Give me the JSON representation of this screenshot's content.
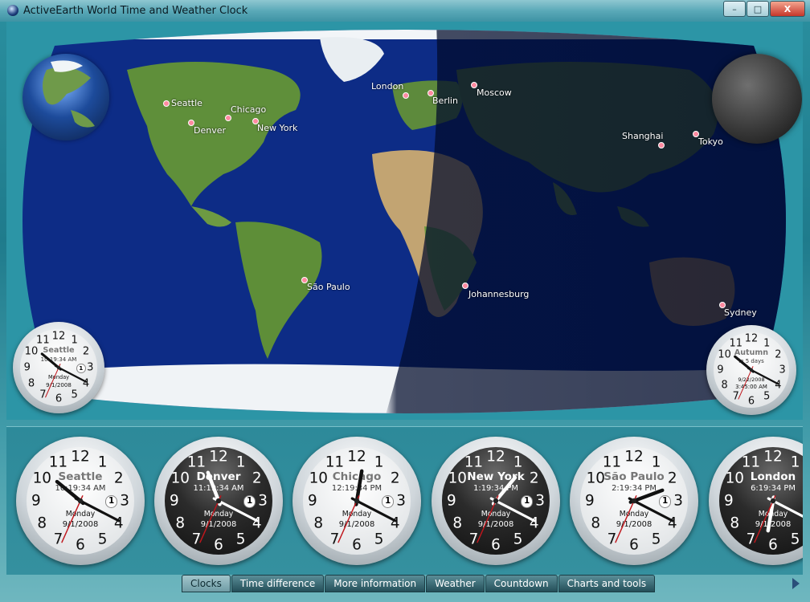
{
  "window": {
    "title": "ActiveEarth World Time and Weather Clock"
  },
  "controls": {
    "minimize": "–",
    "maximize": "□",
    "close": "X"
  },
  "map": {
    "cities": [
      {
        "name": "Seattle"
      },
      {
        "name": "Denver"
      },
      {
        "name": "Chicago"
      },
      {
        "name": "New York"
      },
      {
        "name": "London"
      },
      {
        "name": "Berlin"
      },
      {
        "name": "Moscow"
      },
      {
        "name": "Shanghai"
      },
      {
        "name": "Tokyo"
      },
      {
        "name": "São Paulo"
      },
      {
        "name": "Johannesburg"
      },
      {
        "name": "Sydney"
      }
    ]
  },
  "small_clocks": [
    {
      "city": "Seattle",
      "time": "10:19:34 AM",
      "day": "Monday",
      "date": "9/1/2008",
      "badge": "1",
      "theme": "light"
    },
    {
      "city": "Autumn",
      "time": "in 5 days",
      "day": "9/22/2008",
      "date": "3:45:00 AM",
      "badge": "",
      "theme": "light"
    }
  ],
  "clocks": [
    {
      "city": "Seattle",
      "time": "10:19:34 AM",
      "day": "Monday",
      "date": "9/1/2008",
      "badge": "1",
      "theme": "light"
    },
    {
      "city": "Denver",
      "time": "11:19:34 AM",
      "day": "Monday",
      "date": "9/1/2008",
      "badge": "1",
      "theme": "dark"
    },
    {
      "city": "Chicago",
      "time": "12:19:34 PM",
      "day": "Monday",
      "date": "9/1/2008",
      "badge": "1",
      "theme": "light"
    },
    {
      "city": "New York",
      "time": "1:19:34 PM",
      "day": "Monday",
      "date": "9/1/2008",
      "badge": "1",
      "theme": "dark"
    },
    {
      "city": "São Paulo",
      "time": "2:19:34 PM",
      "day": "Monday",
      "date": "9/1/2008",
      "badge": "1",
      "theme": "light"
    },
    {
      "city": "London",
      "time": "6:19:34 PM",
      "day": "Monday",
      "date": "9/1/2008",
      "badge": "",
      "theme": "dark"
    }
  ],
  "tabs": [
    {
      "label": "Clocks",
      "active": true
    },
    {
      "label": "Time difference"
    },
    {
      "label": "More information"
    },
    {
      "label": "Weather"
    },
    {
      "label": "Countdown"
    },
    {
      "label": "Charts and tools"
    }
  ]
}
